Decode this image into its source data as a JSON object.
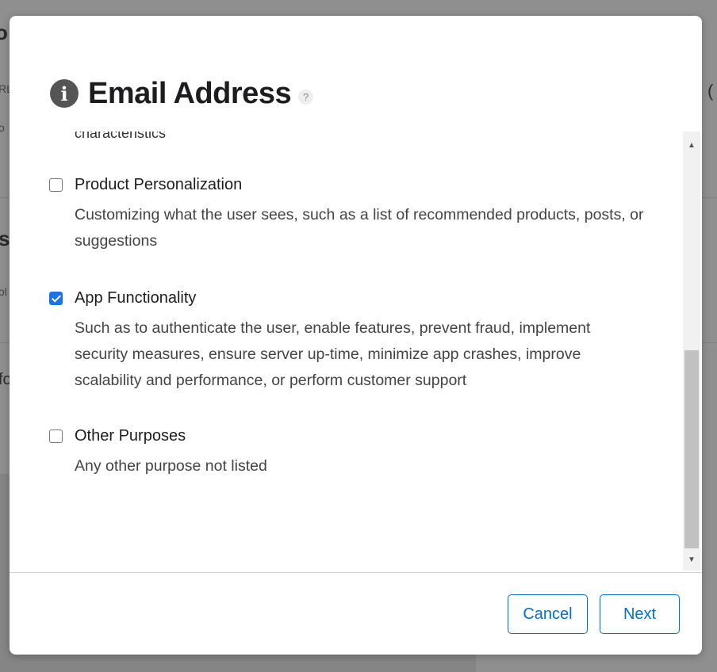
{
  "background": {
    "fragments": [
      "o",
      "RL",
      "o",
      "s",
      "ol",
      "fo",
      "("
    ]
  },
  "dialog": {
    "title": "Email Address",
    "help_glyph": "?",
    "info_glyph": "i",
    "cut_text": "characteristics",
    "options": [
      {
        "label": "Product Personalization",
        "description": "Customizing what the user sees, such as a list of recommended products, posts, or suggestions",
        "checked": false
      },
      {
        "label": "App Functionality",
        "description": "Such as to authenticate the user, enable features, prevent fraud, implement security measures, ensure server up-time, minimize app crashes, improve scalability and performance, or perform customer support",
        "checked": true
      },
      {
        "label": "Other Purposes",
        "description": "Any other purpose not listed",
        "checked": false
      }
    ],
    "cancel_label": "Cancel",
    "next_label": "Next"
  },
  "colors": {
    "accent": "#0070c9",
    "checkbox_checked": "#1a73e8",
    "overlay": "#8f8f8f"
  },
  "icons": {
    "info": "info-icon",
    "help": "help-icon",
    "scroll_up": "scroll-up-arrow-icon",
    "scroll_down": "scroll-down-arrow-icon"
  }
}
